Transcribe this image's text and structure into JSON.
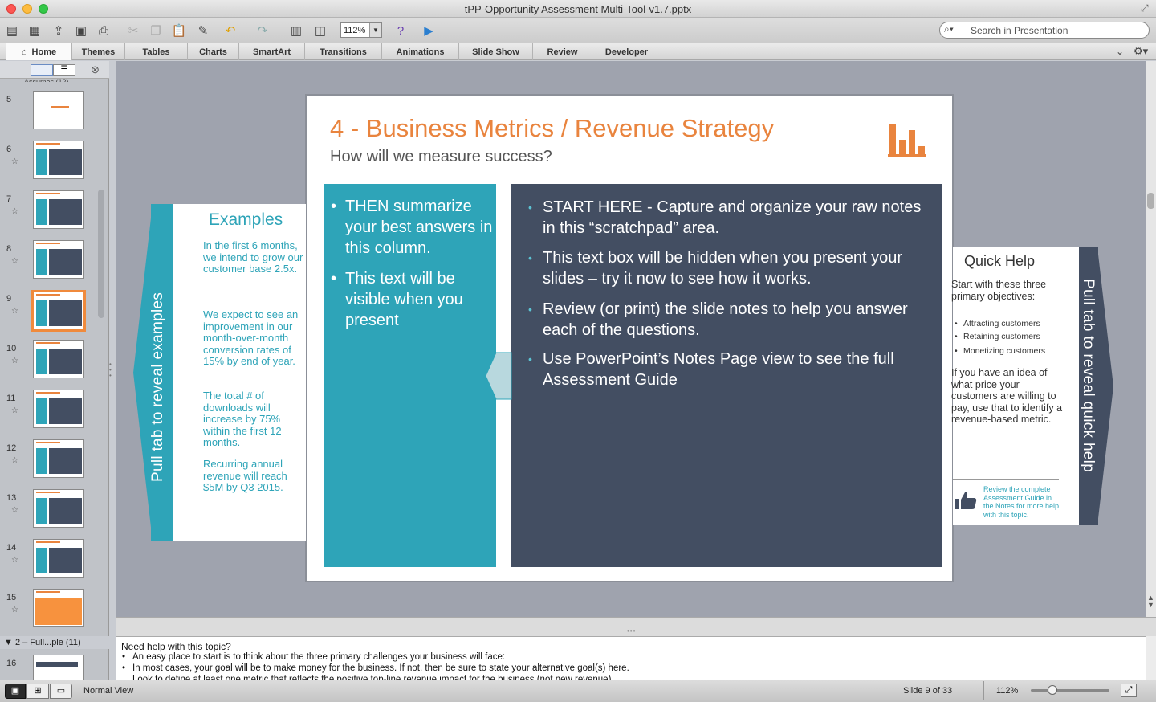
{
  "window": {
    "title": "tPP-Opportunity Assessment Multi-Tool-v1.7.pptx"
  },
  "toolbar": {
    "zoom": "112%",
    "search_placeholder": "Search in Presentation"
  },
  "ribbon": {
    "tabs": [
      "Home",
      "Themes",
      "Tables",
      "Charts",
      "SmartArt",
      "Transitions",
      "Animations",
      "Slide Show",
      "Review",
      "Developer"
    ]
  },
  "sidebar": {
    "top_partial": "Assumes (12)",
    "thumbnails": [
      "5",
      "6",
      "7",
      "8",
      "9",
      "10",
      "11",
      "12",
      "13",
      "14",
      "15"
    ],
    "section": "2 – Full...ple (11)",
    "next_num": "16"
  },
  "slide": {
    "title": "4 - Business Metrics / Revenue Strategy",
    "subtitle": "How will we measure success?",
    "teal_bullets": [
      "THEN summarize your best answers in this column.",
      "This text will be visible when you present"
    ],
    "dark_bullets": [
      "START HERE - Capture and organize your raw notes in this “scratchpad” area.",
      "This text box will be hidden when you present your slides – try it now to see how it works.",
      "Review (or print) the slide notes to help you answer each of the questions.",
      "Use PowerPoint’s Notes Page view to see the full Assessment Guide"
    ],
    "examples": {
      "title": "Examples",
      "pull_tab": "Pull tab to reveal examples",
      "items": [
        "In the first 6 months, we intend to grow our customer base 2.5x.",
        "We expect to see an improvement in our month-over-month conversion rates of 15% by end of year.",
        "The total # of downloads will increase by 75% within the first 12 months.",
        "Recurring annual revenue will reach $5M by Q3 2015."
      ]
    },
    "quick_help": {
      "title": "Quick Help",
      "pull_tab": "Pull tab to reveal quick help",
      "intro": "Start with these three primary objectives:",
      "list": [
        "Attracting customers",
        "Retaining customers",
        "Monetizing customers"
      ],
      "body": "If you have an idea of what price your customers are willing to pay, use that to identify a revenue-based metric.",
      "footer": "Review the complete Assessment Guide in the Notes for more help with this topic."
    }
  },
  "notes": {
    "heading": "Need help with this topic?",
    "items": [
      "An easy place to start is to think about the three primary challenges your business will face:",
      "In most cases, your goal will be to make money for the business. If not, then be sure to state your alternative goal(s) here.",
      "Look to define at least one metric that reflects the positive top-line revenue impact for the business (not new revenue)."
    ]
  },
  "status": {
    "view": "Normal View",
    "slide": "Slide 9 of 33",
    "zoom": "112%"
  },
  "colors": {
    "accent_orange": "#e9843e",
    "teal": "#2ea4b8",
    "slate": "#434e62"
  }
}
